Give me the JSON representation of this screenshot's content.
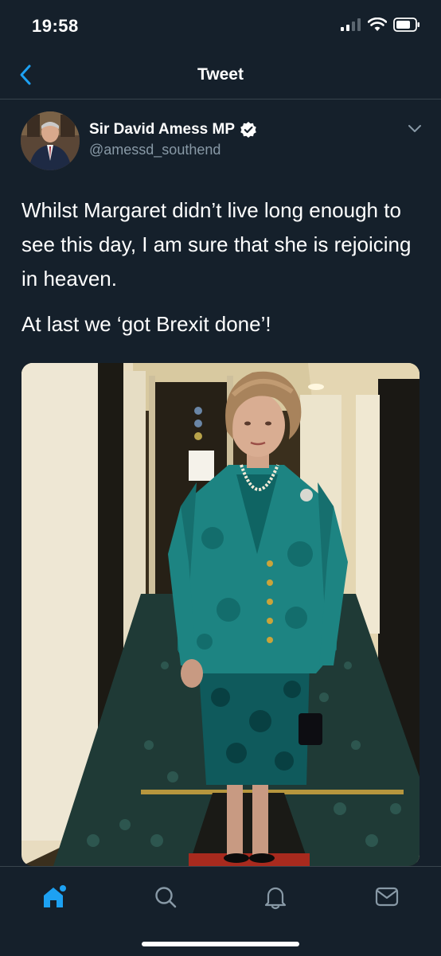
{
  "status_bar": {
    "time": "19:58"
  },
  "header": {
    "title": "Tweet"
  },
  "tweet": {
    "author_name": "Sir David Amess MP",
    "handle": "@amessd_southend",
    "text_lines": [
      "Whilst Margaret didn’t live long enough to see this day, I am sure that she is rejoicing in heaven.",
      "At last we ‘got Brexit done’!"
    ]
  },
  "tab_bar": {
    "items": [
      "home-icon",
      "search-icon",
      "notifications-icon",
      "messages-icon"
    ],
    "active": "home"
  },
  "colors": {
    "background": "#15202b",
    "accent": "#1da1f2",
    "secondary_text": "#8899a6",
    "divider": "#38444d"
  }
}
